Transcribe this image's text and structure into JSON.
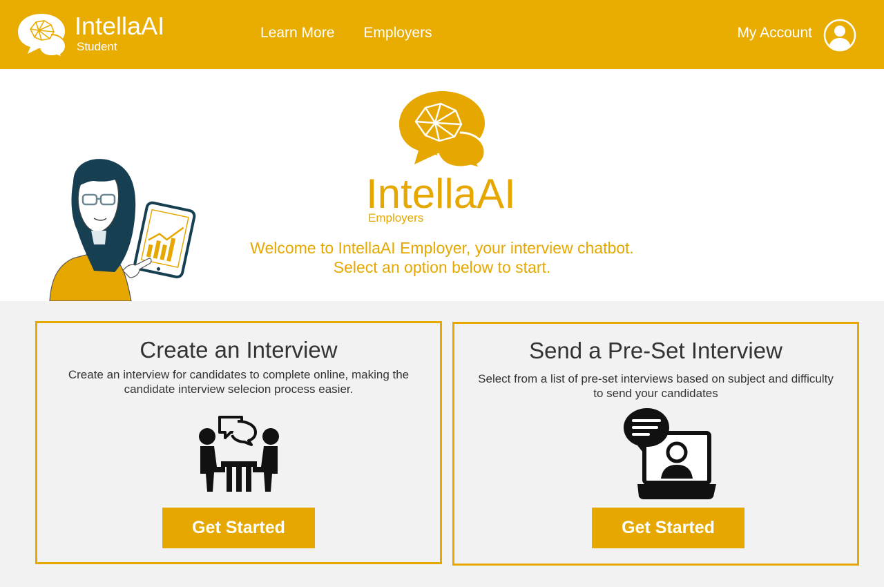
{
  "header": {
    "brand_name": "IntellaAI",
    "brand_sub": "Student",
    "nav": [
      "Learn More",
      "Employers"
    ],
    "account_label": "My Account"
  },
  "hero": {
    "title": "IntellaAI",
    "subtitle": "Employers",
    "welcome": "Welcome to IntellaAI Employer, your interview chatbot. Select an option below to start."
  },
  "cards": [
    {
      "title": "Create an Interview",
      "description": "Create an interview for candidates to complete online, making the candidate interview selecion process easier.",
      "button": "Get Started",
      "icon": "interview-meeting-icon"
    },
    {
      "title": "Send a Pre-Set Interview",
      "description": "Select from a list of pre-set interviews based on subject and difficulty to send your candidates",
      "button": "Get Started",
      "icon": "video-interview-icon"
    }
  ],
  "colors": {
    "brand": "#e9ac00",
    "accent": "#e6a800",
    "background": "#f2f2f2"
  }
}
